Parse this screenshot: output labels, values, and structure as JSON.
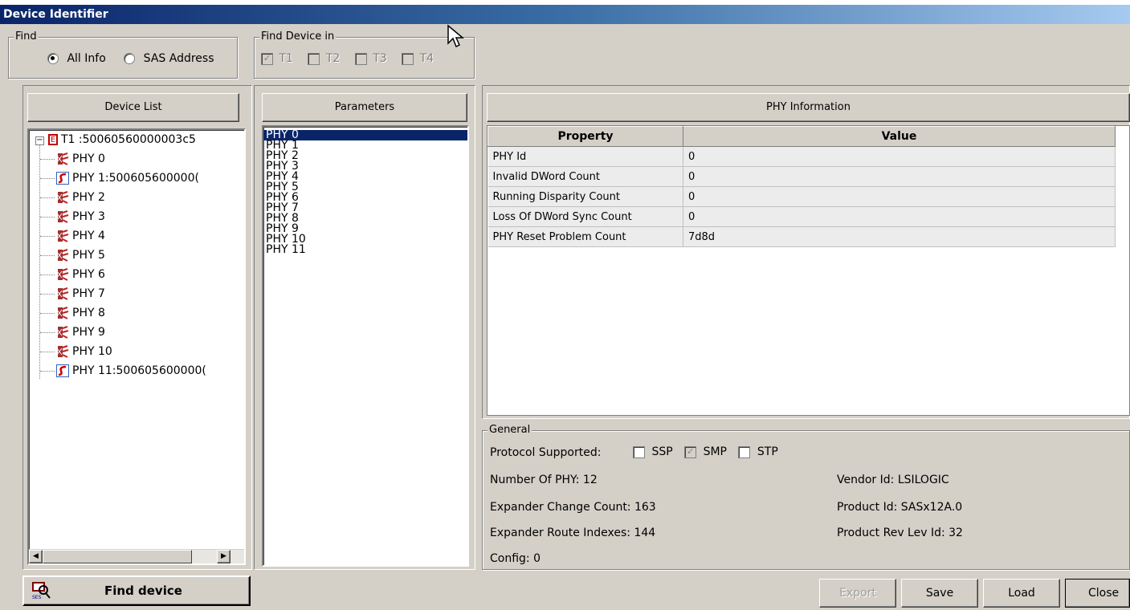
{
  "window": {
    "title": "Device Identifier"
  },
  "find": {
    "legend": "Find",
    "options": [
      "All Info",
      "SAS Address"
    ],
    "selected": "All Info"
  },
  "find_device_in": {
    "legend": "Find Device in",
    "targets": [
      {
        "label": "T1",
        "checked": true
      },
      {
        "label": "T2",
        "checked": false
      },
      {
        "label": "T3",
        "checked": false
      },
      {
        "label": "T4",
        "checked": false
      }
    ]
  },
  "device_list": {
    "header": "Device List",
    "root": "T1 :50060560000003c5",
    "items": [
      {
        "label": "PHY 0",
        "icon": "disconnected-phy-icon"
      },
      {
        "label": "PHY 1:500605600000(",
        "icon": "connected-phy-icon"
      },
      {
        "label": "PHY 2",
        "icon": "disconnected-phy-icon"
      },
      {
        "label": "PHY 3",
        "icon": "disconnected-phy-icon"
      },
      {
        "label": "PHY 4",
        "icon": "disconnected-phy-icon"
      },
      {
        "label": "PHY 5",
        "icon": "disconnected-phy-icon"
      },
      {
        "label": "PHY 6",
        "icon": "disconnected-phy-icon"
      },
      {
        "label": "PHY 7",
        "icon": "disconnected-phy-icon"
      },
      {
        "label": "PHY 8",
        "icon": "disconnected-phy-icon"
      },
      {
        "label": "PHY 9",
        "icon": "disconnected-phy-icon"
      },
      {
        "label": "PHY 10",
        "icon": "disconnected-phy-icon"
      },
      {
        "label": "PHY 11:500605600000(",
        "icon": "connected-phy-icon"
      }
    ]
  },
  "parameters": {
    "header": "Parameters",
    "items": [
      "PHY 0",
      "PHY 1",
      "PHY 2",
      "PHY 3",
      "PHY 4",
      "PHY 5",
      "PHY 6",
      "PHY 7",
      "PHY 8",
      "PHY 9",
      "PHY 10",
      "PHY 11"
    ],
    "selected": "PHY 0"
  },
  "phy_info": {
    "header": "PHY Information",
    "columns": [
      "Property",
      "Value"
    ],
    "rows": [
      [
        "PHY Id",
        "0"
      ],
      [
        "Invalid DWord Count",
        "0"
      ],
      [
        "Running Disparity Count",
        "0"
      ],
      [
        "Loss Of DWord Sync Count",
        "0"
      ],
      [
        "PHY Reset Problem Count",
        "7d8d"
      ]
    ]
  },
  "general": {
    "legend": "General",
    "protocol_label": "Protocol Supported:",
    "protocols": [
      {
        "label": "SSP",
        "checked": false
      },
      {
        "label": "SMP",
        "checked": true
      },
      {
        "label": "STP",
        "checked": false
      }
    ],
    "number_of_phy": "Number Of PHY: 12",
    "expander_change_count": "Expander Change Count: 163",
    "expander_route_indexes": "Expander Route Indexes: 144",
    "config": "Config: 0",
    "vendor_id": "Vendor Id: LSILOGIC",
    "product_id": "Product Id: SASx12A.0",
    "product_rev": "Product Rev Lev Id: 32"
  },
  "buttons": {
    "find_device": "Find device",
    "export": "Export",
    "save": "Save",
    "load": "Load",
    "close": "Close"
  },
  "colors": {
    "title_start": "#0a246a",
    "title_end": "#a6caf0",
    "selection": "#0a246a",
    "face": "#d4d0c8"
  }
}
